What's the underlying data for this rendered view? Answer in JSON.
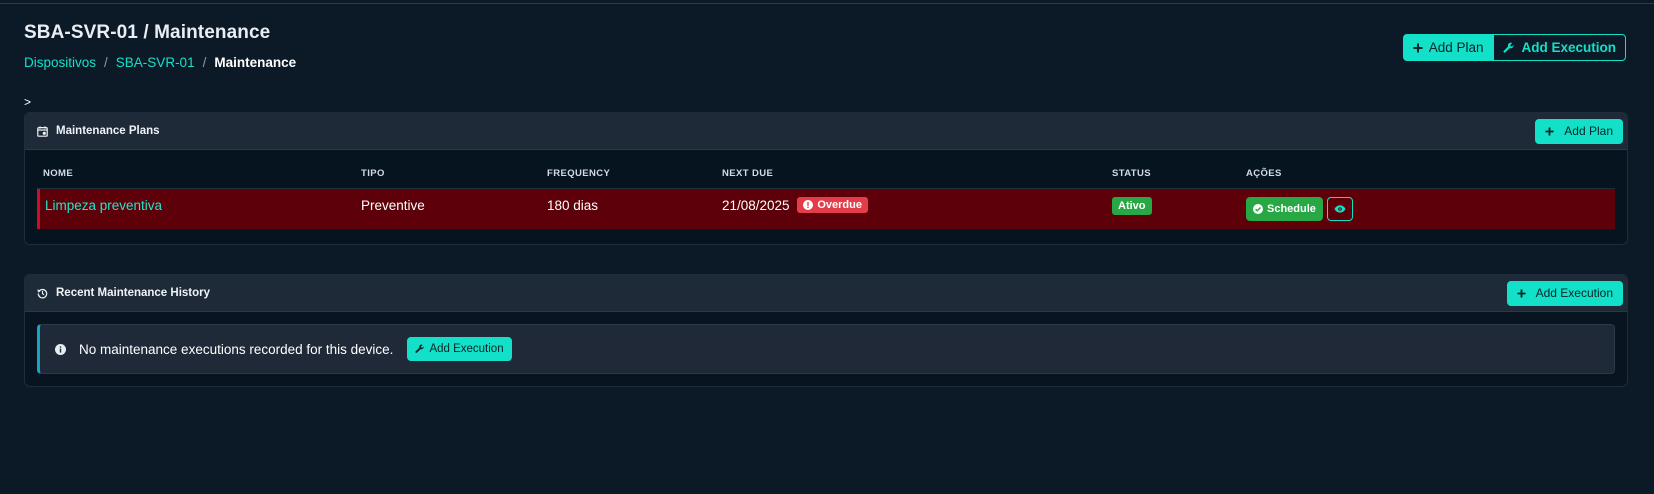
{
  "header": {
    "title": "SBA-SVR-01 / Maintenance",
    "breadcrumb": {
      "items": [
        "Dispositivos",
        "SBA-SVR-01"
      ],
      "separator": "/",
      "current": "Maintenance"
    },
    "actions": {
      "add_plan_label": "Add Plan",
      "add_execution_label": "Add Execution"
    }
  },
  "stray_text": ">",
  "plans": {
    "title": "Maintenance Plans",
    "add_button_label": "Add Plan",
    "columns": [
      "NOME",
      "TIPO",
      "FREQUENCY",
      "NEXT DUE",
      "STATUS",
      "AÇÕES"
    ],
    "rows": [
      {
        "name": "Limpeza preventiva",
        "type": "Preventive",
        "frequency": "180 dias",
        "next_due": "21/08/2025",
        "due_badge": "Overdue",
        "status": "Ativo",
        "schedule_label": "Schedule"
      }
    ]
  },
  "history": {
    "title": "Recent Maintenance History",
    "add_button_label": "Add Execution",
    "empty_message": "No maintenance executions recorded for this device.",
    "empty_action_label": "Add Execution"
  },
  "icons": {
    "plus": "plus-icon",
    "wrench": "wrench-icon",
    "calendar": "calendar-icon",
    "history": "history-icon",
    "info": "info-icon",
    "alert": "exclamation-circle-icon",
    "check": "check-circle-icon",
    "eye": "eye-icon"
  },
  "colors": {
    "accent": "#13e0c8",
    "overdue_row": "#5e0009",
    "overdue_badge": "#e23d48",
    "success": "#28a745",
    "background": "#0c1a28"
  }
}
